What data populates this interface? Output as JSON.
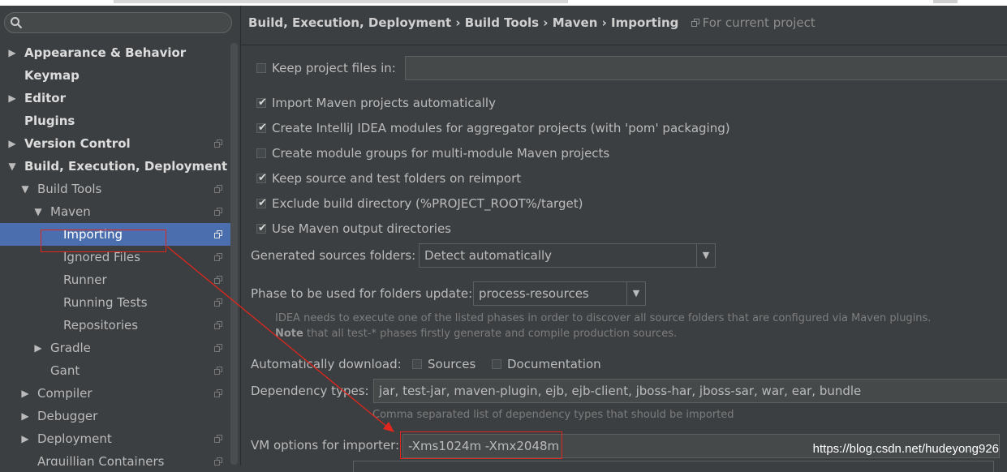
{
  "sidebar": {
    "search_placeholder": "",
    "items": [
      {
        "label": "Appearance & Behavior"
      },
      {
        "label": "Keymap"
      },
      {
        "label": "Editor"
      },
      {
        "label": "Plugins"
      },
      {
        "label": "Version Control"
      },
      {
        "label": "Build, Execution, Deployment"
      },
      {
        "label": "Build Tools"
      },
      {
        "label": "Maven"
      },
      {
        "label": "Importing"
      },
      {
        "label": "Ignored Files"
      },
      {
        "label": "Runner"
      },
      {
        "label": "Running Tests"
      },
      {
        "label": "Repositories"
      },
      {
        "label": "Gradle"
      },
      {
        "label": "Gant"
      },
      {
        "label": "Compiler"
      },
      {
        "label": "Debugger"
      },
      {
        "label": "Deployment"
      },
      {
        "label": "Arquillian Containers"
      }
    ]
  },
  "breadcrumb": {
    "path": "Build, Execution, Deployment › Build Tools › Maven › Importing",
    "scope": "For current project"
  },
  "settings": {
    "keep_project_files": {
      "label": "Keep project files in:",
      "checked": false,
      "value": ""
    },
    "import_auto": {
      "label": "Import Maven projects automatically",
      "checked": true
    },
    "create_modules": {
      "label": "Create IntelliJ IDEA modules for aggregator projects (with 'pom' packaging)",
      "checked": true
    },
    "module_groups": {
      "label": "Create module groups for multi-module Maven projects",
      "checked": false
    },
    "keep_source": {
      "label": "Keep source and test folders on reimport",
      "checked": true
    },
    "exclude_build": {
      "label": "Exclude build directory (%PROJECT_ROOT%/target)",
      "checked": true
    },
    "use_output": {
      "label": "Use Maven output directories",
      "checked": true
    },
    "generated_sources": {
      "label": "Generated sources folders:",
      "value": "Detect automatically"
    },
    "phase": {
      "label": "Phase to be used for folders update:",
      "value": "process-resources"
    },
    "phase_hint_1": "IDEA needs to execute one of the listed phases in order to discover all source folders that are configured via Maven plugins.",
    "phase_hint_note": "Note",
    "phase_hint_2": " that all test-* phases firstly generate and compile production sources.",
    "auto_download": {
      "label": "Automatically download:",
      "sources": "Sources",
      "documentation": "Documentation",
      "sources_checked": false,
      "documentation_checked": false
    },
    "dependency_types": {
      "label": "Dependency types:",
      "value": "jar, test-jar, maven-plugin, ejb, ejb-client, jboss-har, jboss-sar, war, ear, bundle",
      "hint": "Comma separated list of dependency types that should be imported"
    },
    "vm_options": {
      "label": "VM options for importer:",
      "value": "-Xms1024m -Xmx2048m"
    }
  },
  "watermark": "https://blog.csdn.net/hudeyong926",
  "colors": {
    "selection": "#4b6eaf",
    "annotation": "#e0261d",
    "background": "#3c3f41"
  }
}
